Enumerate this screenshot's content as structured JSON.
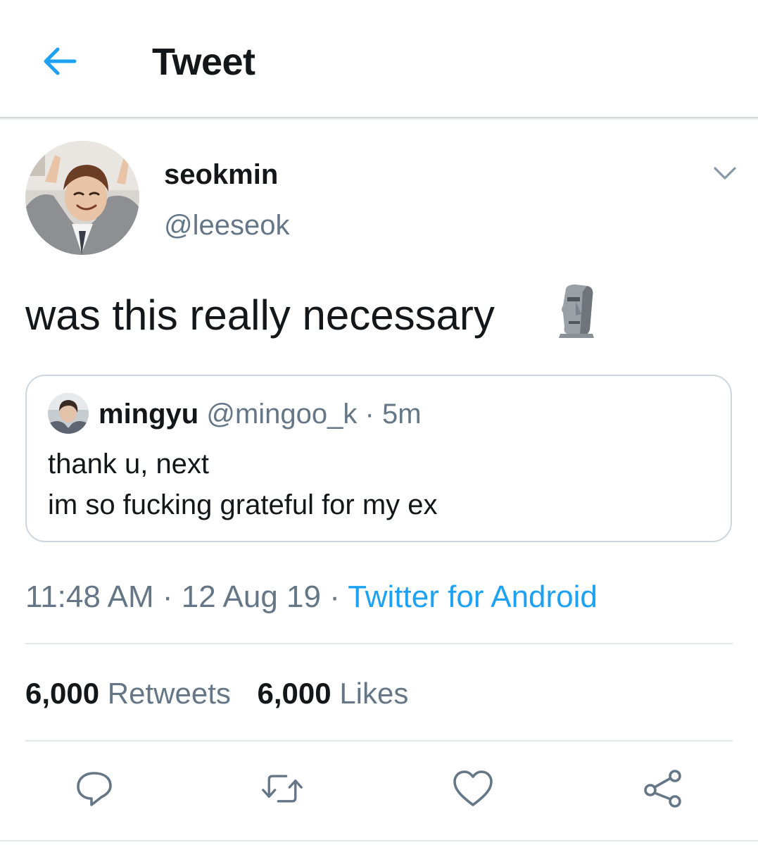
{
  "header": {
    "title": "Tweet",
    "back_icon": "arrow-left-icon"
  },
  "colors": {
    "accent": "#1da1f2",
    "text_primary": "#14171a",
    "text_secondary": "#657786",
    "border": "#ccd6dd"
  },
  "tweet": {
    "author": {
      "name": "seokmin",
      "handle": "@leeseok",
      "avatar": "user-avatar"
    },
    "menu_icon": "chevron-down-icon",
    "text": "was this really necessary",
    "emoji": "moai-emoji",
    "quoted": {
      "name": "mingyu",
      "handle": "@mingoo_k",
      "separator": "·",
      "time": "5m",
      "lines": [
        "thank u, next",
        "im so fucking grateful for my ex"
      ]
    },
    "meta": {
      "time": "11:48 AM",
      "separator": "·",
      "date": "12 Aug 19",
      "source": "Twitter for Android"
    },
    "stats": {
      "retweets_count": "6,000",
      "retweets_label": "Retweets",
      "likes_count": "6,000",
      "likes_label": "Likes"
    },
    "actions": [
      "reply-icon",
      "retweet-icon",
      "like-icon",
      "share-icon"
    ]
  }
}
